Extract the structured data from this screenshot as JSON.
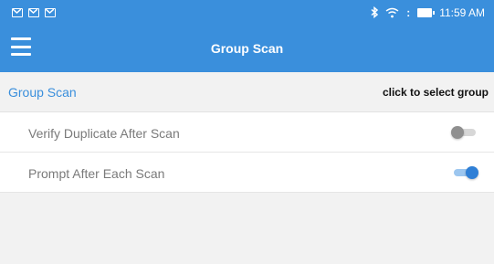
{
  "status_bar": {
    "time": "11:59 AM",
    "icons": [
      "mail-icon",
      "mail-icon",
      "mail-icon",
      "bluetooth-icon",
      "wifi-icon",
      "battery-icon"
    ]
  },
  "app_bar": {
    "title": "Group Scan",
    "menu_icon": "hamburger-menu-icon"
  },
  "group": {
    "label": "Group Scan",
    "action": "click to select group"
  },
  "settings": [
    {
      "label": "Verify Duplicate After Scan",
      "enabled": false
    },
    {
      "label": "Prompt After Each Scan",
      "enabled": true
    }
  ],
  "colors": {
    "primary": "#3a8fdc",
    "toggle_on": "#2f7fd6",
    "toggle_off": "#8f8f8f"
  }
}
